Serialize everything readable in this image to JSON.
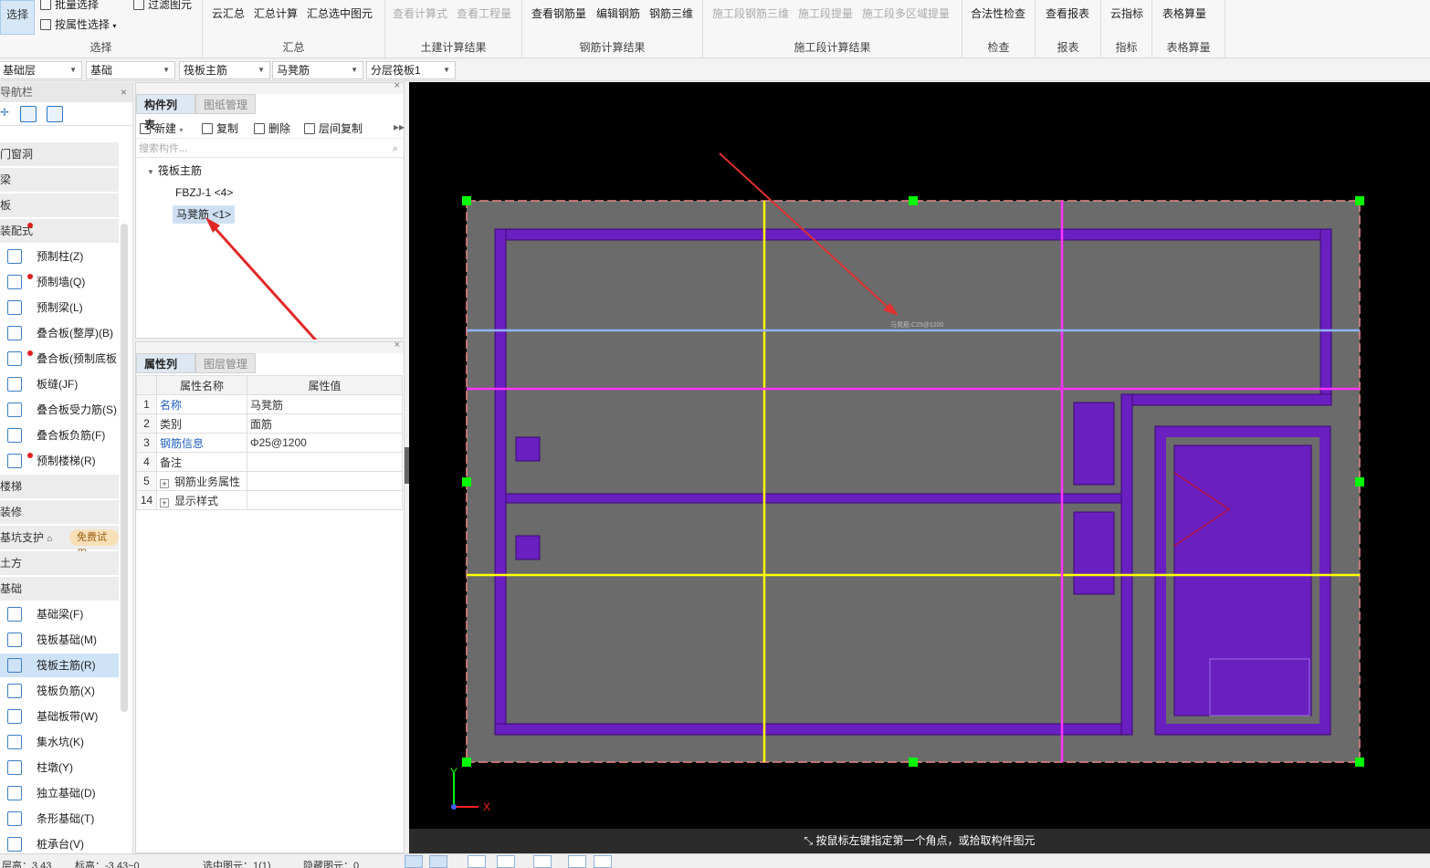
{
  "ribbon": {
    "select_group": {
      "select_label": "选择",
      "batch_select": "批量选择",
      "by_attr_select": "按属性选择",
      "filter_elements": "过滤图元",
      "group_name": "选择"
    },
    "summary_group": {
      "cloud_summary": "云汇总",
      "summary_calc": "汇总计算",
      "summary_selected": "汇总选中图元",
      "group_name": "汇总"
    },
    "civil_group": {
      "view_formula": "查看计算式",
      "view_quantity": "查看工程量",
      "group_name": "土建计算结果"
    },
    "rebar_group": {
      "view_rebar": "查看钢筋量",
      "edit_rebar": "编辑钢筋",
      "rebar_3d": "钢筋三维",
      "group_name": "钢筋计算结果"
    },
    "phase_group": {
      "phase_rebar_3d": "施工段钢筋三维",
      "phase_extract": "施工段提量",
      "phase_multi_extract": "施工段多区域提量",
      "group_name": "施工段计算结果"
    },
    "check_group": {
      "legal_check": "合法性检查",
      "group_name": "检查"
    },
    "report_group": {
      "view_report": "查看报表",
      "group_name": "报表"
    },
    "index_group": {
      "cloud_index": "云指标",
      "group_name": "指标"
    },
    "table_group": {
      "table_calc": "表格算量",
      "group_name": "表格算量"
    }
  },
  "dropdowns": {
    "floor": "基础层",
    "category": "基础",
    "component_type": "筏板主筋",
    "component": "马凳筋",
    "layer": "分层筏板1"
  },
  "nav": {
    "title": "导航栏",
    "categories": {
      "door_window": "门窗洞",
      "beam": "梁",
      "slab": "板",
      "prefab": "装配式",
      "stairs": "楼梯",
      "decor": "装修",
      "pit_support": "基坑支护",
      "earthwork": "土方",
      "foundation": "基础"
    },
    "trial_badge": "免费试用",
    "prefab_items": [
      "预制柱(Z)",
      "预制墙(Q)",
      "预制梁(L)",
      "叠合板(整厚)(B)",
      "叠合板(预制底板",
      "板缝(JF)",
      "叠合板受力筋(S)",
      "叠合板负筋(F)",
      "预制楼梯(R)"
    ],
    "foundation_items": [
      "基础梁(F)",
      "筏板基础(M)",
      "筏板主筋(R)",
      "筏板负筋(X)",
      "基础板带(W)",
      "集水坑(K)",
      "柱墩(Y)",
      "独立基础(D)",
      "条形基础(T)",
      "桩承台(V)"
    ]
  },
  "component_panel": {
    "tab_list": "构件列表",
    "tab_drawings": "图纸管理",
    "new_btn": "新建",
    "copy_btn": "复制",
    "delete_btn": "删除",
    "floor_copy_btn": "层间复制",
    "search_placeholder": "搜索构件...",
    "tree_root": "筏板主筋",
    "tree_items": [
      "FBZJ-1 <4>",
      "马凳筋 <1>"
    ]
  },
  "property_panel": {
    "tab_props": "属性列表",
    "tab_layers": "图层管理",
    "col_name": "属性名称",
    "col_value": "属性值",
    "rows": [
      {
        "num": "1",
        "name": "名称",
        "value": "马凳筋"
      },
      {
        "num": "2",
        "name": "类别",
        "value": "面筋"
      },
      {
        "num": "3",
        "name": "钢筋信息",
        "value": "Φ25@1200"
      },
      {
        "num": "4",
        "name": "备注",
        "value": ""
      },
      {
        "num": "5",
        "name": "钢筋业务属性",
        "value": ""
      },
      {
        "num": "14",
        "name": "显示样式",
        "value": ""
      }
    ]
  },
  "canvas": {
    "rebar_label": "马凳筋:C25@1200",
    "axis_x": "X",
    "axis_y": "Y",
    "colors": {
      "background": "#000000",
      "slab": "#6b6b6b",
      "beam": "#6a1fc0",
      "grip": "#00ff00",
      "axis_yellow": "#ffff00",
      "axis_magenta": "#ff33ff",
      "rebar_line": "#8fb4ff",
      "arrow_red": "#e03030"
    }
  },
  "status": {
    "hint": "按鼠标左键指定第一个角点，或拾取构件图元",
    "elevation_label": "层高：3.43",
    "elevation_range": "标高：-3.43~0",
    "selected": "选中图元：1(1)",
    "hidden": "隐藏图元：0"
  }
}
